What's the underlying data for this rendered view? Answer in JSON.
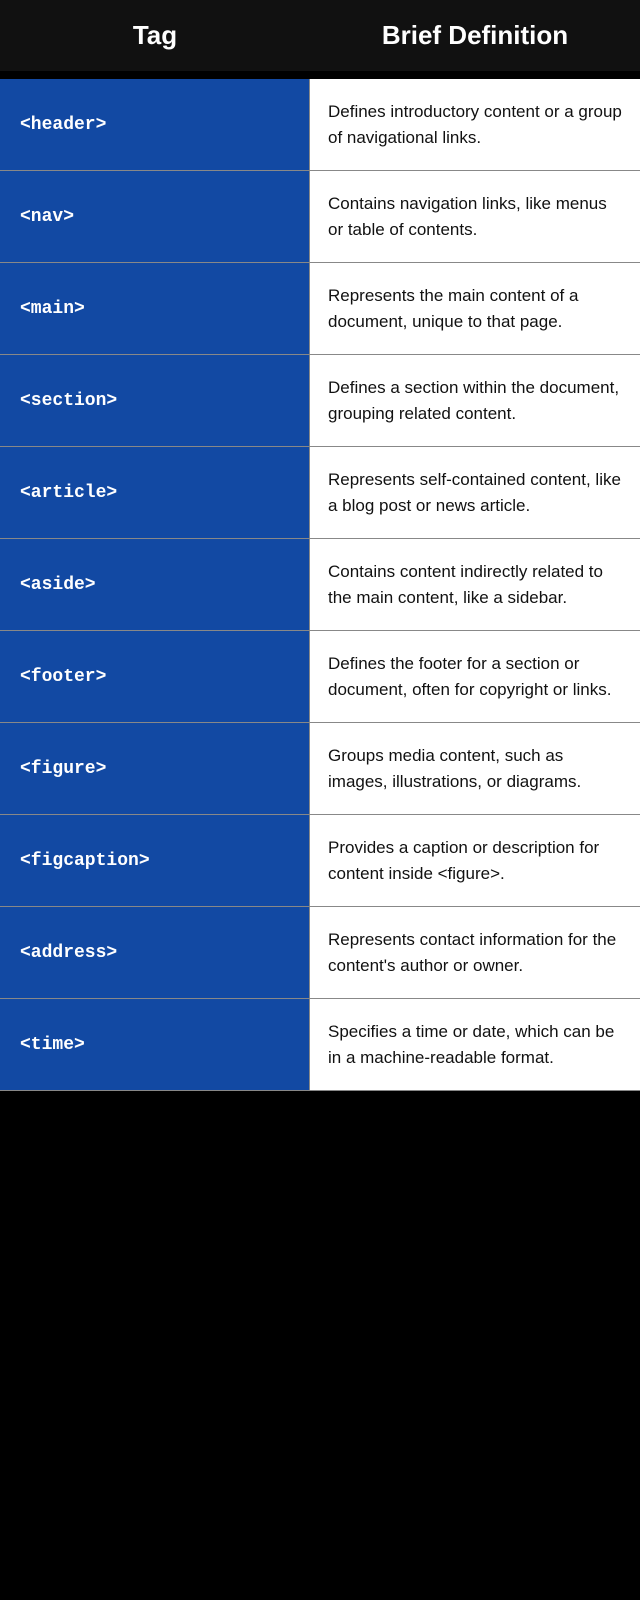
{
  "header": {
    "tag_label": "Tag",
    "definition_label": "Brief Definition"
  },
  "rows": [
    {
      "tag": "<header>",
      "definition": "Defines introductory content or a group of navigational links."
    },
    {
      "tag": "<nav>",
      "definition": "Contains navigation links, like menus or table of contents."
    },
    {
      "tag": "<main>",
      "definition": "Represents the main content of a document, unique to that page."
    },
    {
      "tag": "<section>",
      "definition": "Defines a section within the document, grouping related content."
    },
    {
      "tag": "<article>",
      "definition": "Represents self-contained content, like a blog post or news article."
    },
    {
      "tag": "<aside>",
      "definition": "Contains content indirectly related to the main content, like a sidebar."
    },
    {
      "tag": "<footer>",
      "definition": "Defines the footer for a section or document, often for copyright or links."
    },
    {
      "tag": "<figure>",
      "definition": "Groups media content, such as images, illustrations, or diagrams."
    },
    {
      "tag": "<figcaption>",
      "definition": "Provides a caption or description for content inside <figure>."
    },
    {
      "tag": "<address>",
      "definition": "Represents contact information for the content's author or owner."
    },
    {
      "tag": "<time>",
      "definition": "Specifies a time or date, which can be in a machine-readable format."
    }
  ]
}
